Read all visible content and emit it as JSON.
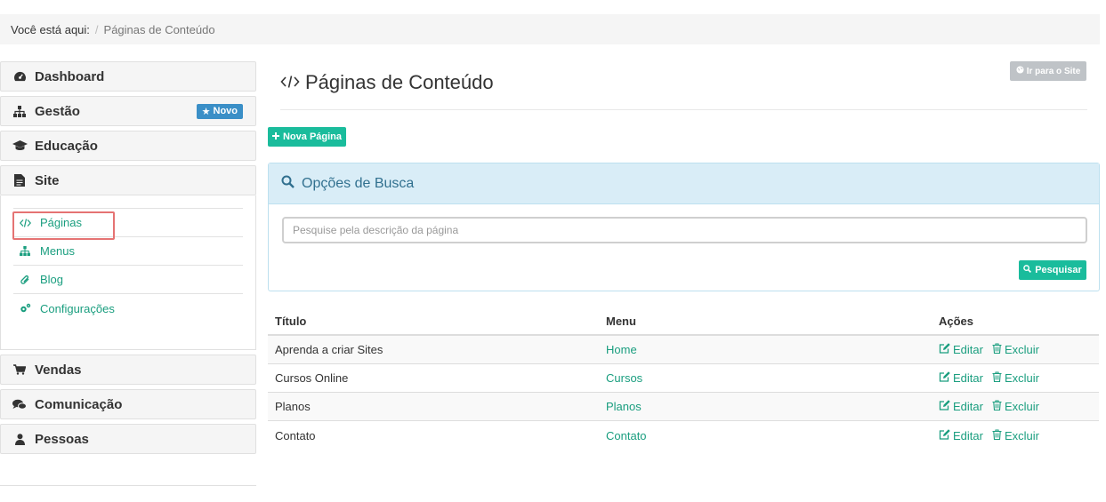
{
  "breadcrumb": {
    "lead": "Você está aqui:",
    "separator": "/",
    "current": "Páginas de Conteúdo"
  },
  "sidebar": {
    "items": [
      {
        "label": "Dashboard",
        "icon": "dashboard-icon"
      },
      {
        "label": "Gestão",
        "icon": "sitemap-icon",
        "badge": "Novo"
      },
      {
        "label": "Educação",
        "icon": "graduation-cap-icon"
      },
      {
        "label": "Site",
        "icon": "file-icon"
      },
      {
        "label": "Vendas",
        "icon": "cart-icon"
      },
      {
        "label": "Comunicação",
        "icon": "comments-icon"
      },
      {
        "label": "Pessoas",
        "icon": "user-icon"
      }
    ],
    "site_sub": [
      {
        "label": "Páginas",
        "icon": "code-icon",
        "active": true
      },
      {
        "label": "Menus",
        "icon": "sitemap-icon"
      },
      {
        "label": "Blog",
        "icon": "paperclip-icon"
      },
      {
        "label": "Configurações",
        "icon": "cogs-icon"
      }
    ]
  },
  "main": {
    "title": "Páginas de Conteúdo",
    "site_button": "Ir para o Site",
    "new_button": "Nova Página",
    "search": {
      "title": "Opções de Busca",
      "placeholder": "Pesquise pela descrição da página",
      "button": "Pesquisar"
    },
    "table": {
      "headers": [
        "Título",
        "Menu",
        "Ações"
      ],
      "rows": [
        {
          "title": "Aprenda a criar Sites",
          "menu": "Home"
        },
        {
          "title": "Cursos Online",
          "menu": "Cursos"
        },
        {
          "title": "Planos",
          "menu": "Planos"
        },
        {
          "title": "Contato",
          "menu": "Contato"
        }
      ],
      "edit_label": "Editar",
      "delete_label": "Excluir"
    }
  },
  "colors": {
    "accent": "#1abc9c",
    "link": "#1a9e7f",
    "badge": "#3a8fc7",
    "panel": "#d9edf7",
    "highlight": "#e57373"
  }
}
